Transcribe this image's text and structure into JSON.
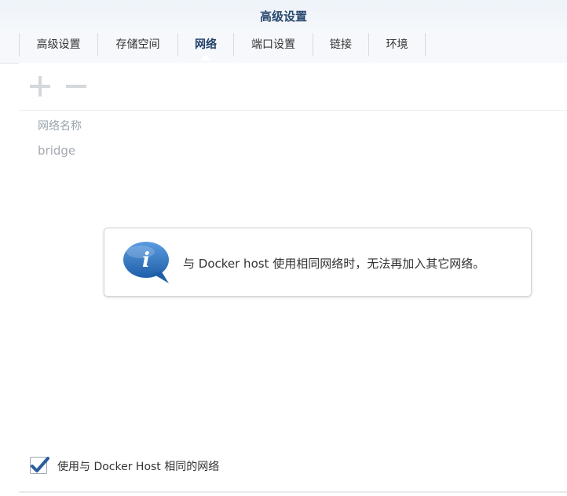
{
  "window": {
    "title": "高级设置"
  },
  "tabs": [
    {
      "label": "高级设置"
    },
    {
      "label": "存储空间"
    },
    {
      "label": "网络",
      "active": true
    },
    {
      "label": "端口设置"
    },
    {
      "label": "链接"
    },
    {
      "label": "环境"
    }
  ],
  "toolbar": {
    "add_icon": "plus-icon",
    "remove_icon": "minus-icon"
  },
  "network_table": {
    "column_header": "网络名称",
    "rows": [
      {
        "name": "bridge"
      }
    ]
  },
  "info_message": {
    "icon": "info-speech-bubble-icon",
    "text": "与 Docker host 使用相同网络时，无法再加入其它网络。"
  },
  "host_network_option": {
    "label": "使用与 Docker Host 相同的网络",
    "checked": true
  },
  "colors": {
    "title": "#2a4a6f",
    "active_tab": "#1f3f66",
    "info_icon": "#2f6fb5",
    "checkmark": "#2a5d9a"
  }
}
